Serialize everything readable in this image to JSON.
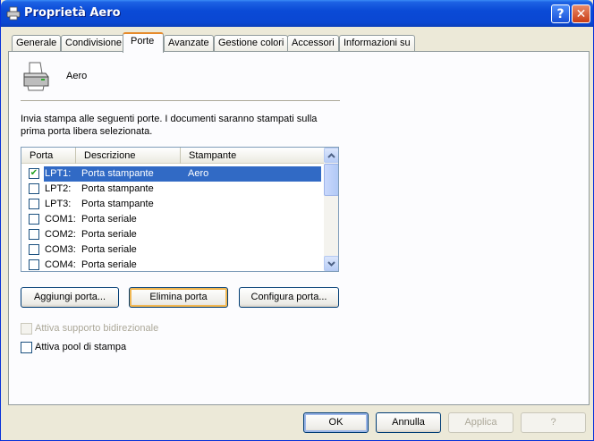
{
  "window": {
    "title": "Proprietà Aero",
    "help_label": "?",
    "close_label": "✕"
  },
  "tabs": [
    {
      "label": "Generale"
    },
    {
      "label": "Condivisione"
    },
    {
      "label": "Porte",
      "active": true
    },
    {
      "label": "Avanzate"
    },
    {
      "label": "Gestione colori"
    },
    {
      "label": "Accessori"
    },
    {
      "label": "Informazioni su"
    }
  ],
  "printer": {
    "name": "Aero",
    "icon": "printer-icon"
  },
  "description": "Invia stampa alle seguenti porte. I documenti saranno stampati sulla prima porta libera selezionata.",
  "port_list": {
    "columns": [
      "Porta",
      "Descrizione",
      "Stampante"
    ],
    "rows": [
      {
        "port": "LPT1:",
        "description": "Porta stampante",
        "printer": "Aero",
        "checked": true,
        "selected": true
      },
      {
        "port": "LPT2:",
        "description": "Porta stampante",
        "printer": "",
        "checked": false
      },
      {
        "port": "LPT3:",
        "description": "Porta stampante",
        "printer": "",
        "checked": false
      },
      {
        "port": "COM1:",
        "description": "Porta seriale",
        "printer": "",
        "checked": false
      },
      {
        "port": "COM2:",
        "description": "Porta seriale",
        "printer": "",
        "checked": false
      },
      {
        "port": "COM3:",
        "description": "Porta seriale",
        "printer": "",
        "checked": false
      },
      {
        "port": "COM4:",
        "description": "Porta seriale",
        "printer": "",
        "checked": false
      }
    ]
  },
  "port_buttons": {
    "add": "Aggiungi porta...",
    "delete": "Elimina porta",
    "configure": "Configura porta..."
  },
  "options": {
    "bidirectional": "Attiva supporto bidirezionale",
    "pooling": "Attiva pool di stampa"
  },
  "dialog_buttons": {
    "ok": "OK",
    "cancel": "Annulla",
    "apply": "Applica",
    "help": "?"
  },
  "colors": {
    "titlebar": "#0a4ad6",
    "selection": "#316ac5",
    "active_tab_accent": "#e68b2c"
  }
}
